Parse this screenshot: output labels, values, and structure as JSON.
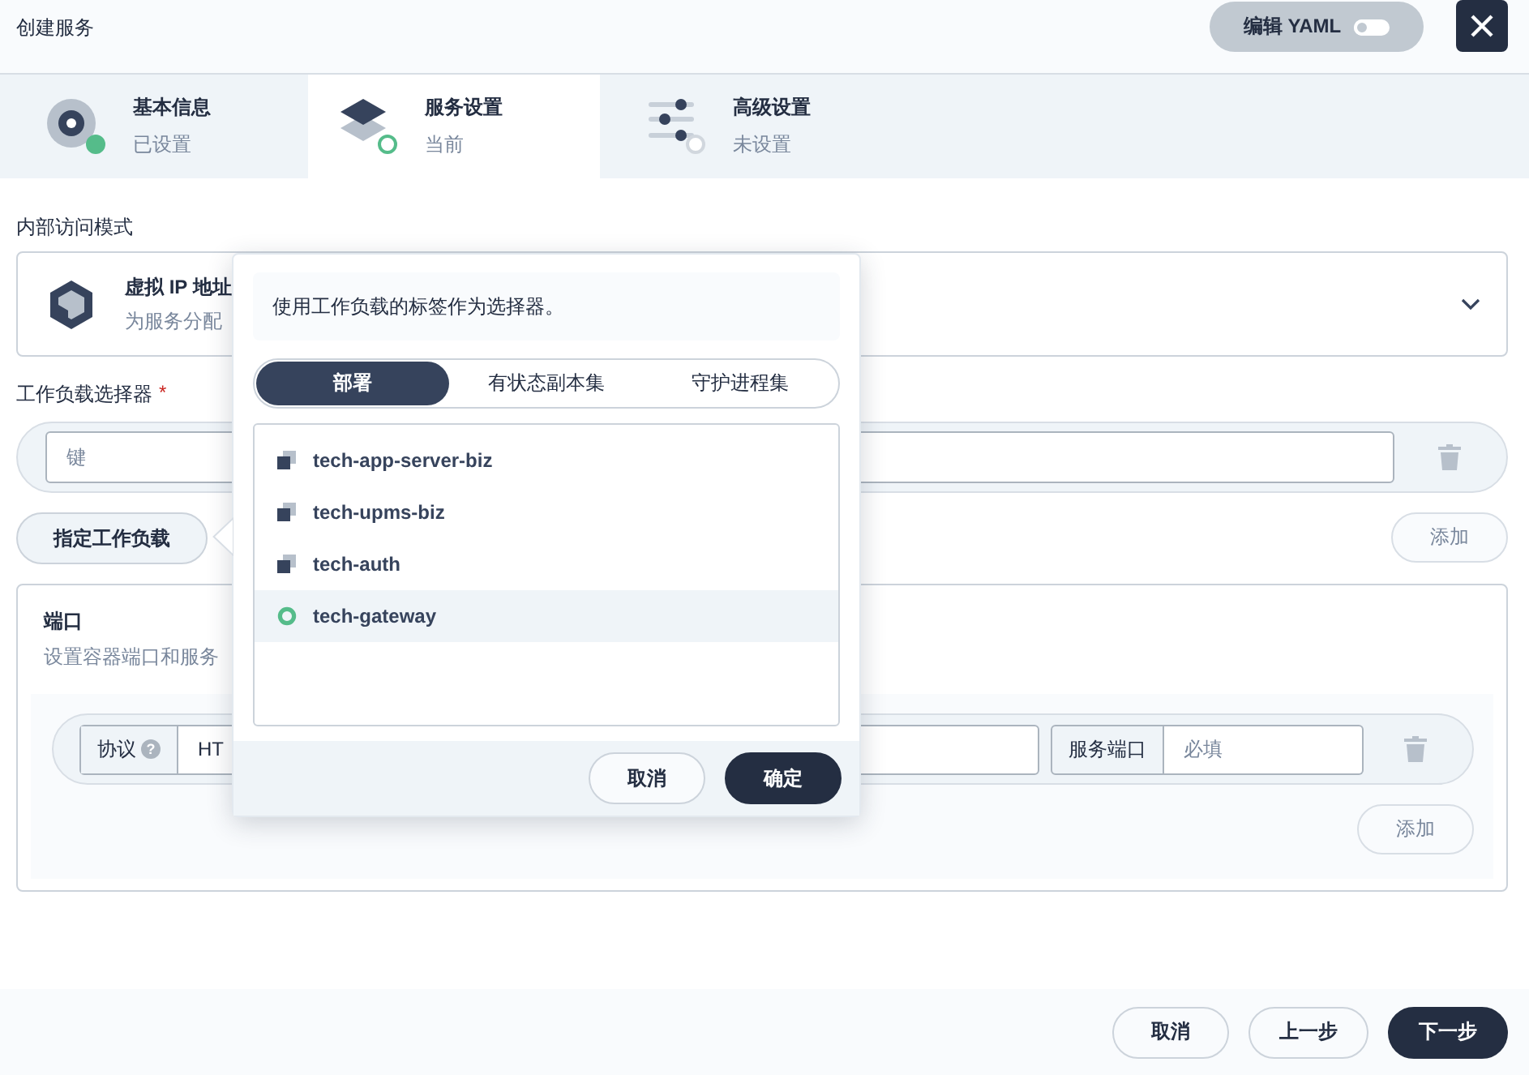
{
  "window": {
    "title": "创建服务"
  },
  "yaml_toggle": {
    "label": "编辑 YAML",
    "on": false
  },
  "steps": [
    {
      "title": "基本信息",
      "status_text": "已设置",
      "kind": "disk",
      "done": true,
      "selected": false
    },
    {
      "title": "服务设置",
      "status_text": "当前",
      "kind": "layers",
      "done": false,
      "selected": true
    },
    {
      "title": "高级设置",
      "status_text": "未设置",
      "kind": "sliders",
      "done": false,
      "selected": false
    }
  ],
  "access_mode": {
    "label": "内部访问模式",
    "title": "虚拟 IP 地址",
    "description": "为服务分配"
  },
  "workload_selector": {
    "label": "工作负载选择器",
    "required_mark": "*",
    "key_placeholder": "键",
    "specify_button": "指定工作负载",
    "add_button": "添加"
  },
  "ports": {
    "title": "端口",
    "description": "设置容器端口和服务",
    "protocol_label": "协议",
    "help_icon": "?",
    "protocol_value": "HT",
    "service_port_label": "服务端口",
    "service_port_placeholder": "必填",
    "add_button": "添加"
  },
  "popover": {
    "hint": "使用工作负载的标签作为选择器。",
    "tabs": [
      {
        "label": "部署",
        "selected": true
      },
      {
        "label": "有状态副本集",
        "selected": false
      },
      {
        "label": "守护进程集",
        "selected": false
      }
    ],
    "items": [
      {
        "name": "tech-app-server-biz",
        "selected": false
      },
      {
        "name": "tech-upms-biz",
        "selected": false
      },
      {
        "name": "tech-auth",
        "selected": false
      },
      {
        "name": "tech-gateway",
        "selected": true
      }
    ],
    "cancel": "取消",
    "confirm": "确定"
  },
  "footer": {
    "buttons": [
      {
        "label": "取消",
        "primary": false
      },
      {
        "label": "上一步",
        "primary": false
      },
      {
        "label": "下一步",
        "primary": true
      }
    ]
  }
}
